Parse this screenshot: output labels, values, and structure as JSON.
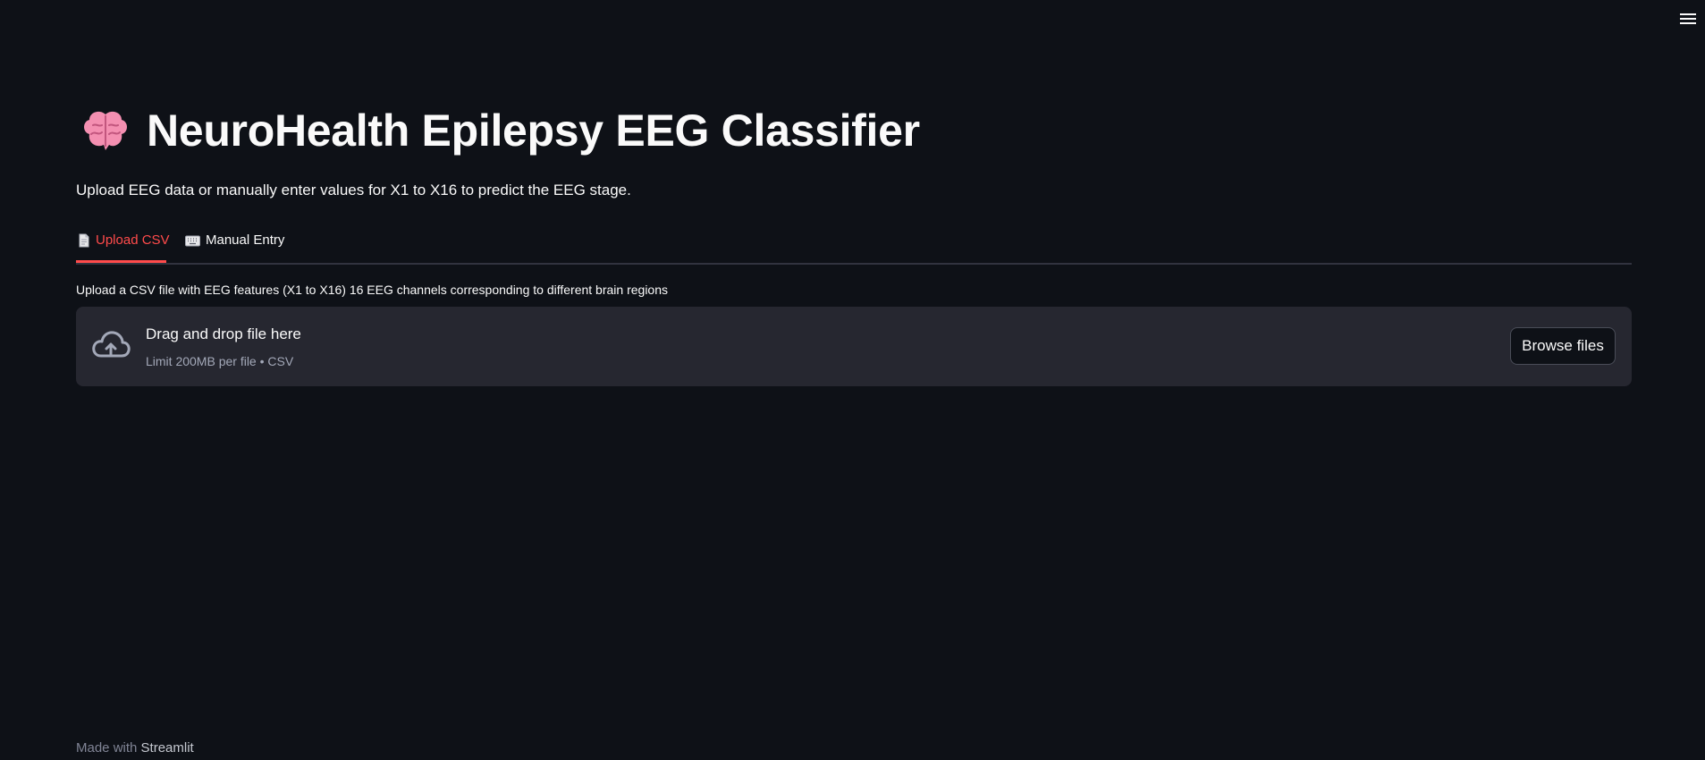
{
  "header": {
    "title": "NeuroHealth Epilepsy EEG Classifier",
    "subtitle": "Upload EEG data or manually enter values for X1 to X16 to predict the EEG stage.",
    "title_icon": "brain-emoji-icon"
  },
  "tabs": [
    {
      "label": "Upload CSV",
      "icon": "page-icon",
      "active": true
    },
    {
      "label": "Manual Entry",
      "icon": "keyboard-icon",
      "active": false
    }
  ],
  "uploader": {
    "label": "Upload a CSV file with EEG features (X1 to X16) 16 EEG channels corresponding to different brain regions",
    "drop_text": "Drag and drop file here",
    "limit_text": "Limit 200MB per file • CSV",
    "browse_label": "Browse files",
    "icon": "cloud-upload-icon"
  },
  "footer": {
    "prefix": "Made with",
    "brand": "Streamlit"
  },
  "menu": {
    "icon": "hamburger-menu-icon"
  },
  "colors": {
    "background": "#0e1117",
    "accent": "#ff4b4b",
    "surface": "#262730",
    "text": "#fafafa",
    "muted": "#a3a8b8"
  }
}
